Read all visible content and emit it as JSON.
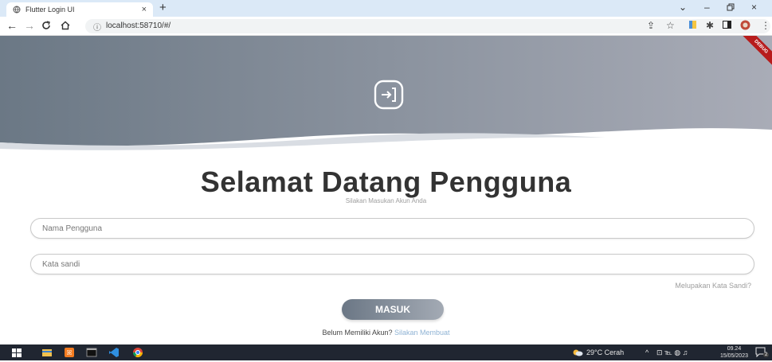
{
  "browser": {
    "tab_title": "Flutter Login UI",
    "tab_close": "×",
    "new_tab": "+",
    "url": "localhost:58710/#/",
    "window_controls": {
      "minimize": "–",
      "maximize": "ㅁ",
      "close": "×",
      "dropdown": "⌄"
    }
  },
  "app": {
    "debug_banner": "DEBUG",
    "title": "Selamat Datang Pengguna",
    "subtitle": "Silakan Masukan Akun Anda",
    "username_placeholder": "Nama Pengguna",
    "password_placeholder": "Kata sandi",
    "forgot_password": "Melupakan Kata Sandi?",
    "login_button": "MASUK",
    "signup_prompt": "Belum Memiliki Akun?",
    "signup_link": "Silakan Membuat",
    "header_gradient": [
      "#6b7885",
      "#a9acb7"
    ]
  },
  "taskbar": {
    "weather": "29°C  Cerah",
    "time": "09.24",
    "date": "15/05/2023",
    "notifications": "2"
  }
}
